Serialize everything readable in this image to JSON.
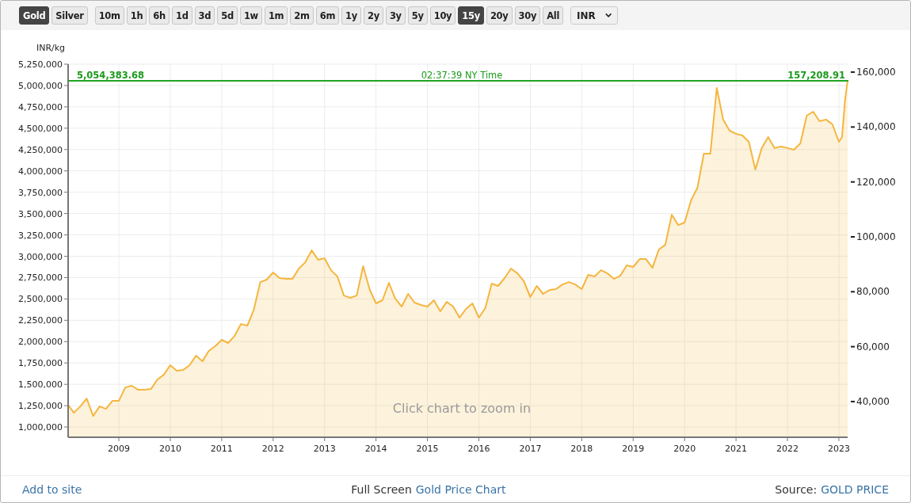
{
  "toolbar": {
    "metals": [
      {
        "label": "Gold",
        "selected": true
      },
      {
        "label": "Silver",
        "selected": false
      }
    ],
    "ranges": [
      {
        "label": "10m",
        "selected": false
      },
      {
        "label": "1h",
        "selected": false
      },
      {
        "label": "6h",
        "selected": false
      },
      {
        "label": "1d",
        "selected": false
      },
      {
        "label": "3d",
        "selected": false
      },
      {
        "label": "5d",
        "selected": false
      },
      {
        "label": "1w",
        "selected": false
      },
      {
        "label": "1m",
        "selected": false
      },
      {
        "label": "2m",
        "selected": false
      },
      {
        "label": "6m",
        "selected": false
      },
      {
        "label": "1y",
        "selected": false
      },
      {
        "label": "2y",
        "selected": false
      },
      {
        "label": "3y",
        "selected": false
      },
      {
        "label": "5y",
        "selected": false
      },
      {
        "label": "10y",
        "selected": false
      },
      {
        "label": "15y",
        "selected": true
      },
      {
        "label": "20y",
        "selected": false
      },
      {
        "label": "30y",
        "selected": false
      },
      {
        "label": "All",
        "selected": false
      }
    ],
    "currency": "INR"
  },
  "chart": {
    "hint": "Click chart to zoom in",
    "chart_data": {
      "type": "area",
      "ylabel": "INR/kg",
      "xlim": [
        2008.014,
        2023.17
      ],
      "ylim": [
        880000,
        5250000
      ],
      "xticks": [
        2009,
        2010,
        2011,
        2012,
        2013,
        2014,
        2015,
        2016,
        2017,
        2018,
        2019,
        2020,
        2021,
        2022,
        2023
      ],
      "yticks": [
        {
          "value": 1000000,
          "label": "1,000,000"
        },
        {
          "value": 1250000,
          "label": "1,250,000"
        },
        {
          "value": 1500000,
          "label": "1,500,000"
        },
        {
          "value": 1750000,
          "label": "1,750,000"
        },
        {
          "value": 2000000,
          "label": "2,000,000"
        },
        {
          "value": 2250000,
          "label": "2,250,000"
        },
        {
          "value": 2500000,
          "label": "2,500,000"
        },
        {
          "value": 2750000,
          "label": "2,750,000"
        },
        {
          "value": 3000000,
          "label": "3,000,000"
        },
        {
          "value": 3250000,
          "label": "3,250,000"
        },
        {
          "value": 3500000,
          "label": "3,500,000"
        },
        {
          "value": 3750000,
          "label": "3,750,000"
        },
        {
          "value": 4000000,
          "label": "4,000,000"
        },
        {
          "value": 4250000,
          "label": "4,250,000"
        },
        {
          "value": 4500000,
          "label": "4,500,000"
        },
        {
          "value": 4750000,
          "label": "4,750,000"
        },
        {
          "value": 5000000,
          "label": "5,000,000"
        },
        {
          "value": 5250000,
          "label": "5,250,000"
        }
      ],
      "y2lim": [
        27000,
        162900
      ],
      "y2ticks": [
        {
          "value": 40000,
          "label": "40,000"
        },
        {
          "value": 60000,
          "label": "60,000"
        },
        {
          "value": 80000,
          "label": "80,000"
        },
        {
          "value": 100000,
          "label": "100,000"
        },
        {
          "value": 120000,
          "label": "120,000"
        },
        {
          "value": 140000,
          "label": "140,000"
        },
        {
          "value": 160000,
          "label": "160,000"
        }
      ],
      "x": [
        2008.014,
        2008.125,
        2008.25,
        2008.375,
        2008.5,
        2008.625,
        2008.75,
        2008.875,
        2009,
        2009.125,
        2009.25,
        2009.375,
        2009.5,
        2009.625,
        2009.75,
        2009.875,
        2010,
        2010.125,
        2010.25,
        2010.375,
        2010.5,
        2010.625,
        2010.75,
        2010.875,
        2011,
        2011.125,
        2011.25,
        2011.375,
        2011.5,
        2011.625,
        2011.75,
        2011.875,
        2012,
        2012.125,
        2012.25,
        2012.375,
        2012.5,
        2012.625,
        2012.75,
        2012.875,
        2013,
        2013.125,
        2013.25,
        2013.375,
        2013.5,
        2013.625,
        2013.75,
        2013.875,
        2014,
        2014.125,
        2014.25,
        2014.375,
        2014.5,
        2014.625,
        2014.75,
        2014.875,
        2015,
        2015.125,
        2015.25,
        2015.375,
        2015.5,
        2015.625,
        2015.75,
        2015.875,
        2016,
        2016.125,
        2016.25,
        2016.375,
        2016.5,
        2016.625,
        2016.75,
        2016.875,
        2017,
        2017.125,
        2017.25,
        2017.375,
        2017.5,
        2017.625,
        2017.75,
        2017.875,
        2018,
        2018.125,
        2018.25,
        2018.375,
        2018.5,
        2018.625,
        2018.75,
        2018.875,
        2019,
        2019.125,
        2019.25,
        2019.375,
        2019.5,
        2019.625,
        2019.75,
        2019.875,
        2020,
        2020.125,
        2020.25,
        2020.375,
        2020.5,
        2020.625,
        2020.75,
        2020.875,
        2021,
        2021.125,
        2021.25,
        2021.375,
        2021.5,
        2021.625,
        2021.75,
        2021.875,
        2022,
        2022.125,
        2022.25,
        2022.375,
        2022.5,
        2022.625,
        2022.75,
        2022.875,
        2023,
        2023.06,
        2023.12,
        2023.17
      ],
      "series": [
        {
          "color": "#f4b63f",
          "values": [
            1260000,
            1167000,
            1241000,
            1334000,
            1130000,
            1241000,
            1213000,
            1306000,
            1306000,
            1464000,
            1483000,
            1436000,
            1436000,
            1445000,
            1557000,
            1612000,
            1724000,
            1659000,
            1668000,
            1724000,
            1835000,
            1770000,
            1891000,
            1947000,
            2021000,
            1984000,
            2067000,
            2206000,
            2188000,
            2373000,
            2698000,
            2726000,
            2810000,
            2745000,
            2735000,
            2735000,
            2856000,
            2930000,
            3069000,
            2958000,
            2977000,
            2837000,
            2763000,
            2540000,
            2513000,
            2540000,
            2884000,
            2615000,
            2448000,
            2485000,
            2689000,
            2503000,
            2411000,
            2559000,
            2457000,
            2429000,
            2411000,
            2485000,
            2355000,
            2466000,
            2411000,
            2281000,
            2383000,
            2448000,
            2281000,
            2392000,
            2680000,
            2652000,
            2745000,
            2856000,
            2800000,
            2708000,
            2522000,
            2652000,
            2559000,
            2605000,
            2615000,
            2670000,
            2698000,
            2670000,
            2615000,
            2782000,
            2763000,
            2837000,
            2800000,
            2735000,
            2772000,
            2893000,
            2875000,
            2967000,
            2967000,
            2865000,
            3079000,
            3134000,
            3487000,
            3366000,
            3394000,
            3654000,
            3803000,
            4202000,
            4202000,
            4972000,
            4601000,
            4471000,
            4434000,
            4415000,
            4341000,
            4016000,
            4267000,
            4396000,
            4267000,
            4285000,
            4267000,
            4248000,
            4322000,
            4647000,
            4693000,
            4582000,
            4601000,
            4545000,
            4341000,
            4396000,
            4833000,
            5055000
          ]
        }
      ],
      "ref_lines": [
        {
          "axis": "y",
          "value": 5054383.68,
          "label": "5,054,383.68",
          "color": "#22a322"
        }
      ],
      "grid": true
    },
    "price_line": {
      "time": "02:37:39 NY Time",
      "oz_price": "157,208.91"
    }
  },
  "footer": {
    "add_link": "Add to site",
    "fullscreen_prefix": "Full Screen",
    "fullscreen_link": "Gold Price Chart",
    "source_prefix": "Source:",
    "source_link": "GOLD PRICE"
  }
}
